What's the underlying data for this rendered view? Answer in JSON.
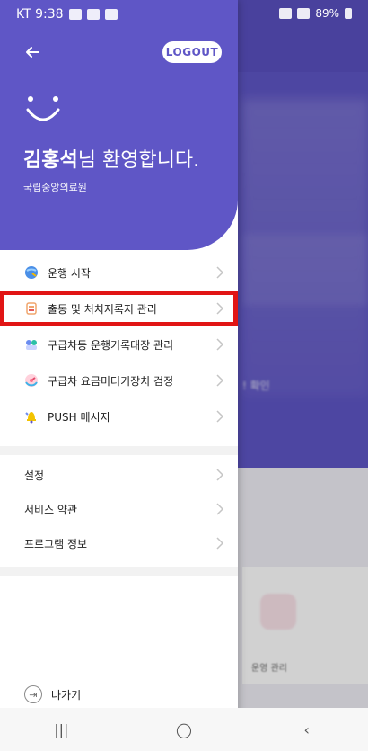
{
  "status_bar": {
    "time": "KT 9:38",
    "right_text": "89%",
    "colors": {
      "text": "#ffffff"
    }
  },
  "drawer": {
    "logout_label": "LOGOUT",
    "welcome_name": "김홍석",
    "welcome_rest": "님 환영합니다.",
    "org_link": "국립중앙의료원"
  },
  "menu": {
    "items": [
      {
        "label": "운행 시작",
        "icon": "globe-icon"
      },
      {
        "label": "출동 및 처치지록지 관리",
        "icon": "medical-record-icon",
        "highlighted": true
      },
      {
        "label": "구급차등 운행기록대장 관리",
        "icon": "people-icon"
      },
      {
        "label": "구급차 요금미터기장치 검정",
        "icon": "meter-icon"
      },
      {
        "label": "PUSH 메시지",
        "icon": "bell-icon"
      }
    ]
  },
  "settings": {
    "items": [
      {
        "label": "설정"
      },
      {
        "label": "서비스 약관"
      },
      {
        "label": "프로그램 정보"
      }
    ]
  },
  "exit": {
    "label": "나가기"
  },
  "background": {
    "blur_text": "! 확인",
    "card_label": "운영 관리"
  },
  "nav": {
    "recent": "|||",
    "home": "◯",
    "back": "‹"
  },
  "theme": {
    "primary": "#5f56c6",
    "highlight": "#e11515"
  }
}
